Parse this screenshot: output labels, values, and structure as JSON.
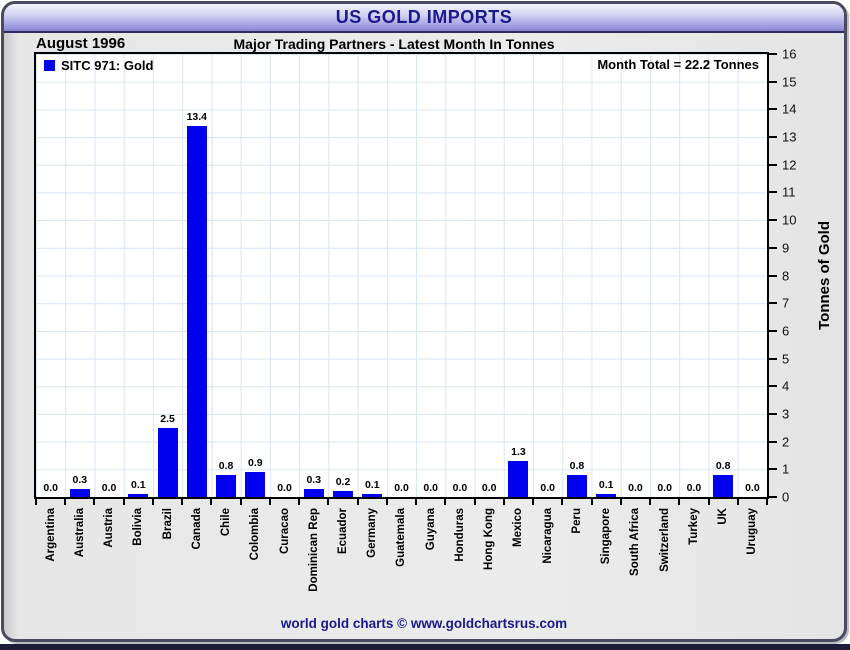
{
  "title_bar": {
    "title": "US GOLD IMPORTS"
  },
  "footer": {
    "text": "world gold charts © www.goldchartsrus.com"
  },
  "chart_data": {
    "type": "bar",
    "title": "US GOLD IMPORTS",
    "period_label": "August 1996",
    "subtitle": "Major Trading Partners - Latest Month In Tonnes",
    "annotation": "Month Total = 22.2 Tonnes",
    "legend": [
      {
        "name": "SITC 971: Gold",
        "color": "#0000ee"
      }
    ],
    "legend_position": "top-left",
    "ylabel": "Tonnes of Gold",
    "ylim": [
      0,
      16
    ],
    "yticks": [
      0,
      1,
      2,
      3,
      4,
      5,
      6,
      7,
      8,
      9,
      10,
      11,
      12,
      13,
      14,
      15,
      16
    ],
    "grid": true,
    "bar_color": "#0000ee",
    "categories": [
      "Argentina",
      "Australia",
      "Austria",
      "Bolivia",
      "Brazil",
      "Canada",
      "Chile",
      "Colombia",
      "Curacao",
      "Dominican Rep",
      "Ecuador",
      "Germany",
      "Guatemala",
      "Guyana",
      "Honduras",
      "Hong Kong",
      "Mexico",
      "Nicaragua",
      "Peru",
      "Singapore",
      "South Africa",
      "Switzerland",
      "Turkey",
      "UK",
      "Uruguay"
    ],
    "values": [
      0.0,
      0.3,
      0.0,
      0.1,
      2.5,
      13.4,
      0.8,
      0.9,
      0.0,
      0.3,
      0.2,
      0.1,
      0.0,
      0.0,
      0.0,
      0.0,
      1.3,
      0.0,
      0.8,
      0.1,
      0.0,
      0.0,
      0.0,
      0.8,
      0.0
    ]
  },
  "colors": {
    "bar": "#0000ee",
    "title_text": "#1a1a8c",
    "footer_text": "#1a1a8c",
    "gridline": "#d9e5f1",
    "titlebar_top": "#f4f4ff",
    "titlebar_bottom": "#8585d0"
  }
}
